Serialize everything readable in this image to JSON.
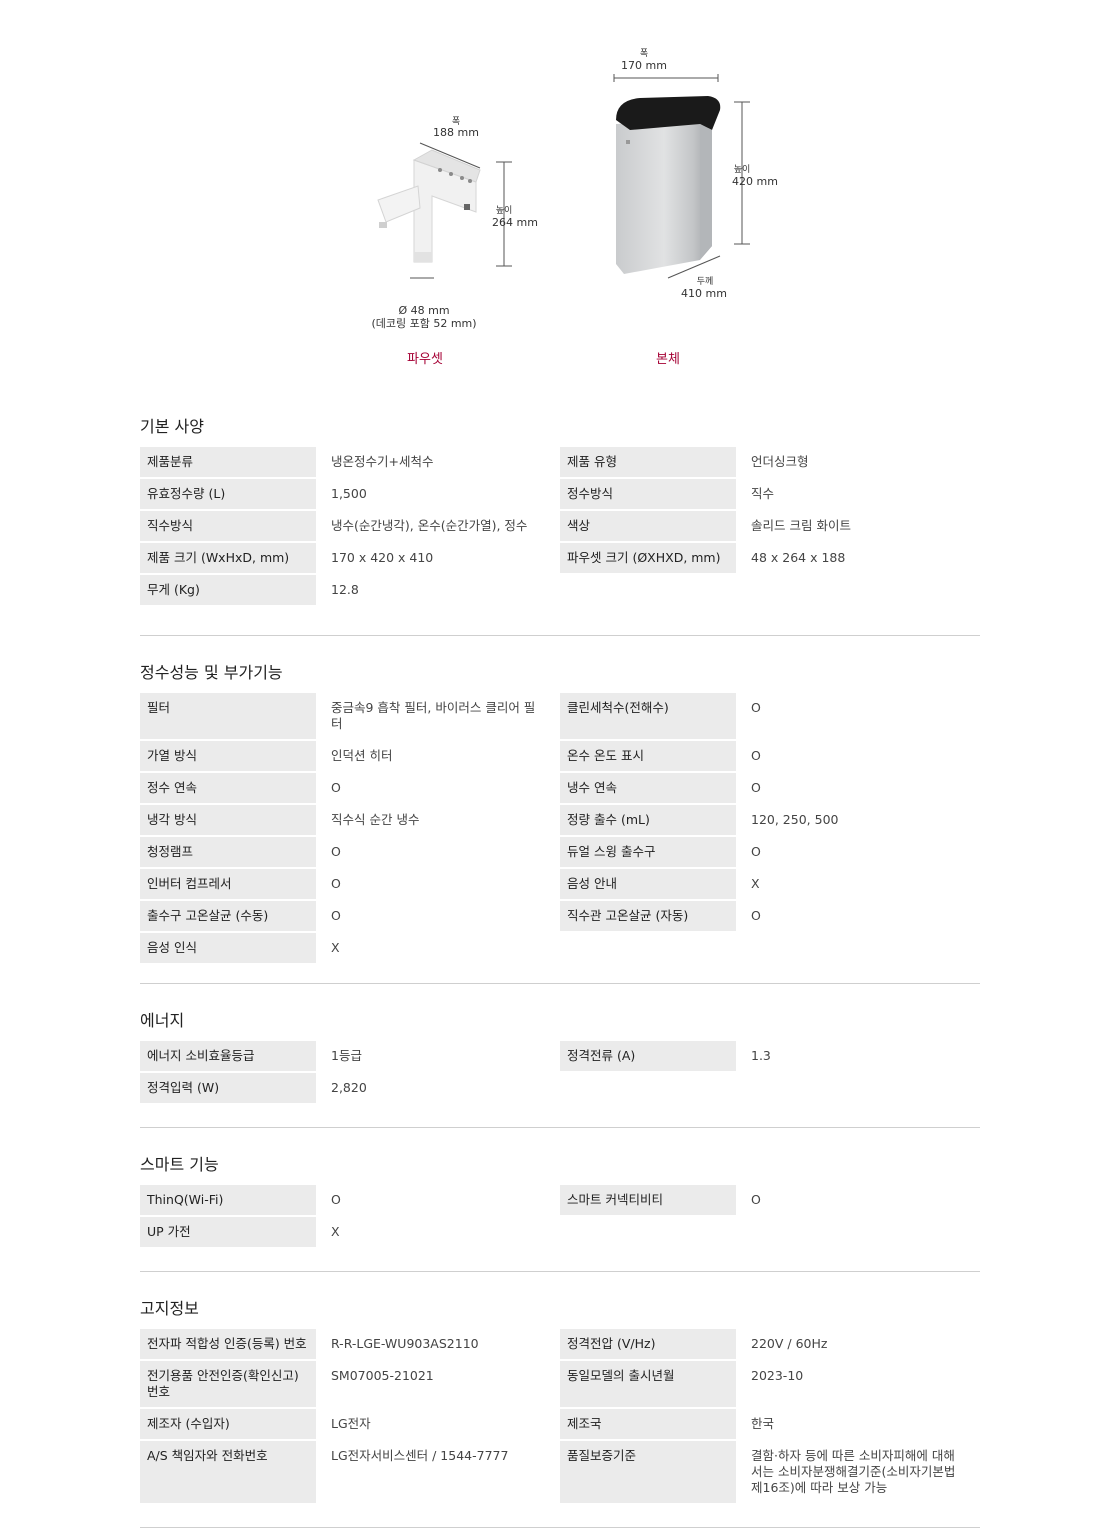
{
  "figures": {
    "faucet": {
      "width_label": "폭",
      "width_value": "188 mm",
      "height_label": "높이",
      "height_value": "264 mm",
      "diameter": "Ø 48 mm",
      "diameter_note": "(데코링 포함 52 mm)",
      "caption": "파우셋"
    },
    "body": {
      "width_label": "폭",
      "width_value": "170 mm",
      "height_label": "높이",
      "height_value": "420 mm",
      "depth_label": "두께",
      "depth_value": "410 mm",
      "caption": "본체"
    }
  },
  "sections": {
    "basic": {
      "title": "기본 사양",
      "rows": [
        [
          "제품분류",
          "냉온정수기+세척수",
          "제품 유형",
          "언더싱크형"
        ],
        [
          "유효정수량 (L)",
          "1,500",
          "정수방식",
          "직수"
        ],
        [
          "직수방식",
          "냉수(순간냉각), 온수(순간가열), 정수",
          "색상",
          "솔리드 크림 화이트"
        ],
        [
          "제품 크기 (WxHxD, mm)",
          "170 x 420 x 410",
          "파우셋 크기 (ØXHXD, mm)",
          "48 x 264 x 188"
        ],
        [
          "무게 (Kg)",
          "12.8"
        ]
      ]
    },
    "performance": {
      "title": "정수성능 및 부가기능",
      "rows": [
        [
          "필터",
          "중금속9 흡착 필터, 바이러스 클리어 필터",
          "클린세척수(전해수)",
          "O"
        ],
        [
          "가열 방식",
          "인덕션 히터",
          "온수 온도 표시",
          "O"
        ],
        [
          "정수 연속",
          "O",
          "냉수 연속",
          "O"
        ],
        [
          "냉각 방식",
          "직수식 순간 냉수",
          "정량 출수 (mL)",
          "120, 250, 500"
        ],
        [
          "청정램프",
          "O",
          "듀얼 스윙 출수구",
          "O"
        ],
        [
          "인버터 컴프레서",
          "O",
          "음성 안내",
          "X"
        ],
        [
          "출수구 고온살균 (수동)",
          "O",
          "직수관 고온살균 (자동)",
          "O"
        ],
        [
          "음성 인식",
          "X"
        ]
      ]
    },
    "energy": {
      "title": "에너지",
      "rows": [
        [
          "에너지 소비효율등급",
          "1등급",
          "정격전류 (A)",
          "1.3"
        ],
        [
          "정격입력 (W)",
          "2,820"
        ]
      ]
    },
    "smart": {
      "title": "스마트 기능",
      "rows": [
        [
          "ThinQ(Wi-Fi)",
          "O",
          "스마트 커넥티비티",
          "O"
        ],
        [
          "UP 가전",
          "X"
        ]
      ]
    },
    "notice": {
      "title": "고지정보",
      "rows": [
        [
          "전자파 적합성 인증(등록) 번호",
          "R-R-LGE-WU903AS2110",
          "정격전압 (V/Hz)",
          "220V / 60Hz"
        ],
        [
          "전기용품 안전인증(확인신고) 번호",
          "SM07005-21021",
          "동일모델의 출시년월",
          "2023-10"
        ],
        [
          "제조자 (수입자)",
          "LG전자",
          "제조국",
          "한국"
        ],
        [
          "A/S 책임자와 전화번호",
          "LG전자서비스센터 / 1544-7777",
          "품질보증기준",
          "결함·하자 등에 따른 소비자피해에 대해서는 소비자분쟁해결기준(소비자기본법 제16조)에 따라 보상 가능"
        ]
      ]
    }
  }
}
